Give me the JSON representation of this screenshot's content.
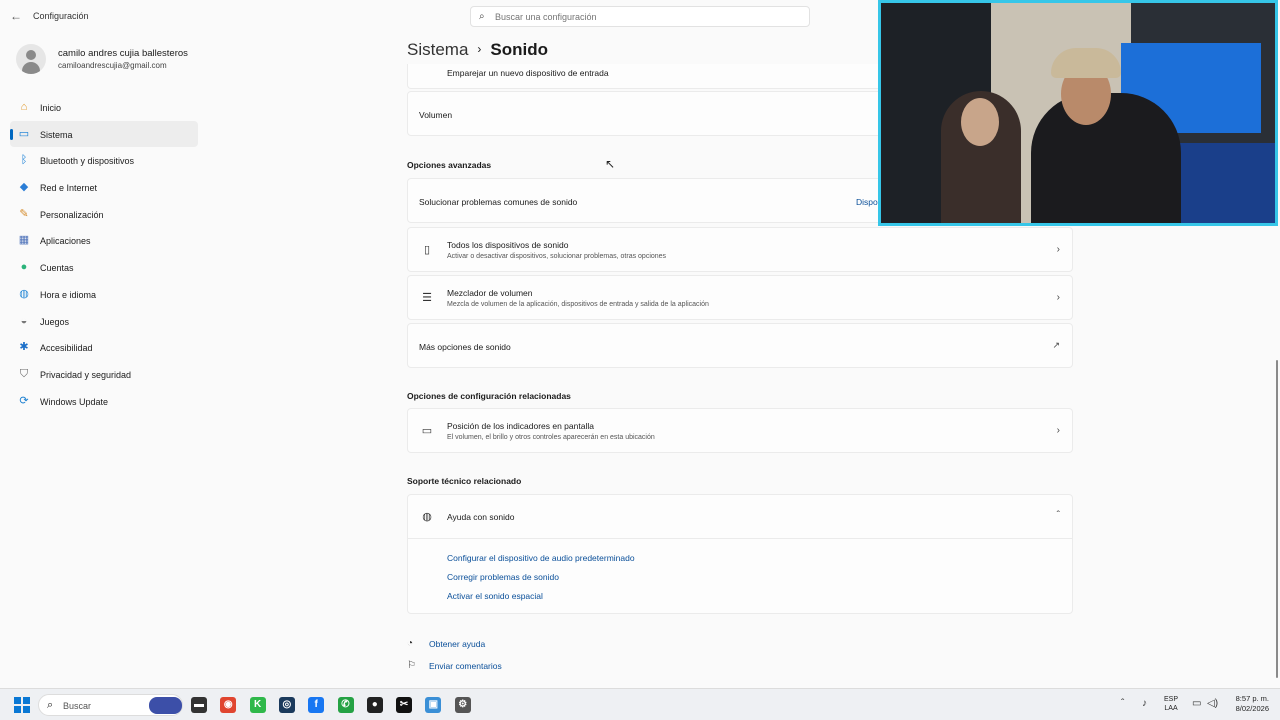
{
  "window": {
    "title": "Configuración"
  },
  "search": {
    "placeholder": "Buscar una configuración"
  },
  "user": {
    "name": "camilo andres cujia ballesteros",
    "email": "camiloandrescujia@gmail.com"
  },
  "sidebar": {
    "items": [
      {
        "label": "Inicio",
        "icon": "home-icon",
        "glyph": "⌂",
        "color": "#e09a2b"
      },
      {
        "label": "Sistema",
        "icon": "system-icon",
        "glyph": "▭",
        "color": "#0a78d4",
        "active": true
      },
      {
        "label": "Bluetooth y dispositivos",
        "icon": "bluetooth-icon",
        "glyph": "ᛒ",
        "color": "#0a78d4"
      },
      {
        "label": "Red e Internet",
        "icon": "wifi-icon",
        "glyph": "◆",
        "color": "#2a7dd6"
      },
      {
        "label": "Personalización",
        "icon": "brush-icon",
        "glyph": "✎",
        "color": "#d48a2a"
      },
      {
        "label": "Aplicaciones",
        "icon": "apps-icon",
        "glyph": "▦",
        "color": "#4a6fb8"
      },
      {
        "label": "Cuentas",
        "icon": "accounts-icon",
        "glyph": "●",
        "color": "#2bb37a"
      },
      {
        "label": "Hora e idioma",
        "icon": "globe-clock-icon",
        "glyph": "◍",
        "color": "#2a8ad6"
      },
      {
        "label": "Juegos",
        "icon": "gamepad-icon",
        "glyph": "◒",
        "color": "#777777"
      },
      {
        "label": "Accesibilidad",
        "icon": "accessibility-icon",
        "glyph": "✱",
        "color": "#1a6fc9"
      },
      {
        "label": "Privacidad y seguridad",
        "icon": "shield-icon",
        "glyph": "⛉",
        "color": "#666666"
      },
      {
        "label": "Windows Update",
        "icon": "update-icon",
        "glyph": "⟳",
        "color": "#1a7fd0"
      }
    ]
  },
  "breadcrumb": {
    "parent": "Sistema",
    "current": "Sonido"
  },
  "content": {
    "partial_row": "Emparejar un nuevo dispositivo de entrada",
    "volume_label": "Volumen",
    "advanced_title": "Opciones avanzadas",
    "troubleshoot": {
      "label": "Solucionar problemas comunes de sonido",
      "action": "Dispo"
    },
    "all_devices": {
      "title": "Todos los dispositivos de sonido",
      "subtitle": "Activar o desactivar dispositivos, solucionar problemas, otras opciones"
    },
    "mixer": {
      "title": "Mezclador de volumen",
      "subtitle": "Mezcla de volumen de la aplicación, dispositivos de entrada y salida de la aplicación"
    },
    "more_options": {
      "label": "Más opciones de sonido"
    },
    "related_title": "Opciones de configuración relacionadas",
    "indicators": {
      "title": "Posición de los indicadores en pantalla",
      "subtitle": "El volumen, el brillo y otros controles aparecerán en esta ubicación"
    },
    "support_title": "Soporte técnico relacionado",
    "help": {
      "title": "Ayuda con sonido",
      "links": [
        "Configurar el dispositivo de audio predeterminado",
        "Corregir problemas de sonido",
        "Activar el sonido espacial"
      ]
    },
    "footer": {
      "get_help": "Obtener ayuda",
      "feedback": "Enviar comentarios"
    }
  },
  "taskbar": {
    "search_label": "Buscar",
    "apps": [
      {
        "icon": "file-explorer-icon",
        "glyph": "▬",
        "color": "#333333"
      },
      {
        "icon": "chrome-icon",
        "glyph": "◉",
        "color": "#e0452f"
      },
      {
        "icon": "kick-icon",
        "glyph": "K",
        "color": "#2fb84a"
      },
      {
        "icon": "steam-icon",
        "glyph": "◎",
        "color": "#1b3a5c"
      },
      {
        "icon": "facebook-icon",
        "glyph": "f",
        "color": "#1877f2"
      },
      {
        "icon": "whatsapp-icon",
        "glyph": "✆",
        "color": "#25a244"
      },
      {
        "icon": "record-app-icon",
        "glyph": "●",
        "color": "#222222"
      },
      {
        "icon": "capcut-icon",
        "glyph": "✂",
        "color": "#111111"
      },
      {
        "icon": "photos-icon",
        "glyph": "▣",
        "color": "#3a8fd6"
      },
      {
        "icon": "settings-icon",
        "glyph": "⚙",
        "color": "#555555"
      }
    ],
    "language": {
      "line1": "ESP",
      "line2": "LAA"
    },
    "clock": {
      "time": "8:57 p. m.",
      "date": "8/02/2026"
    }
  }
}
